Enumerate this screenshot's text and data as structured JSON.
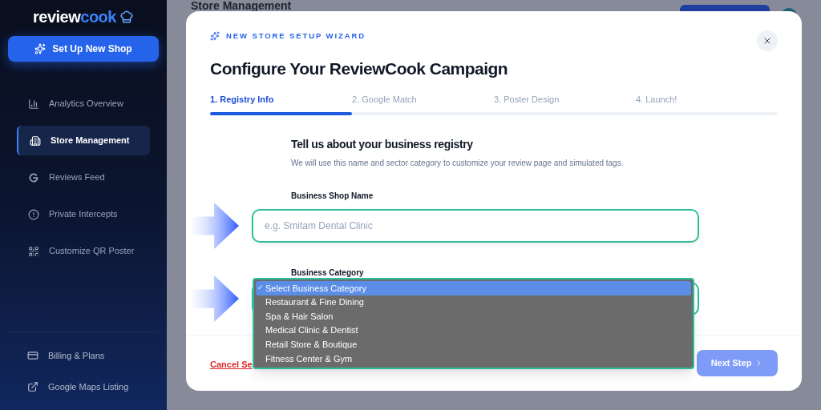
{
  "sidebar": {
    "logo": {
      "part1": "review",
      "part2": "cook"
    },
    "primary_button": "Set Up New Shop",
    "items": [
      {
        "label": "Analytics Overview",
        "selected": false
      },
      {
        "label": "Store Management",
        "selected": true
      },
      {
        "label": "Reviews Feed",
        "selected": false
      },
      {
        "label": "Private Intercepts",
        "selected": false
      },
      {
        "label": "Customize QR Poster",
        "selected": false
      }
    ],
    "bottom_items": [
      {
        "label": "Billing & Plans"
      },
      {
        "label": "Google Maps Listing"
      }
    ]
  },
  "page": {
    "title": "Store Management"
  },
  "modal": {
    "eyebrow": "NEW STORE SETUP WIZARD",
    "title": "Configure Your ReviewCook Campaign",
    "steps": [
      {
        "label": "1. Registry Info",
        "selected": true
      },
      {
        "label": "2. Google Match",
        "selected": false
      },
      {
        "label": "3. Poster Design",
        "selected": false
      },
      {
        "label": "4. Launch!",
        "selected": false
      }
    ],
    "progress": {
      "level": 0.25
    },
    "section_title": "Tell us about your business registry",
    "section_description": "We will use this name and sector category to customize your review page and simulated tags.",
    "shop_name": {
      "label": "Business Shop Name",
      "placeholder": "e.g. Smitam Dental Clinic"
    },
    "category": {
      "label": "Business Category",
      "check_mark": "✓",
      "options": [
        {
          "label": "Select Business Category",
          "selected": true
        },
        {
          "label": "Restaurant & Fine Dining",
          "selected": false
        },
        {
          "label": "Spa & Hair Salon",
          "selected": false
        },
        {
          "label": "Medical Clinic & Dentist",
          "selected": false
        },
        {
          "label": "Retail Store & Boutique",
          "selected": false
        },
        {
          "label": "Fitness Center & Gym",
          "selected": false
        }
      ]
    },
    "cancel": "Cancel Se",
    "next_button": {
      "label": "Next Step",
      "disabled": true
    }
  }
}
